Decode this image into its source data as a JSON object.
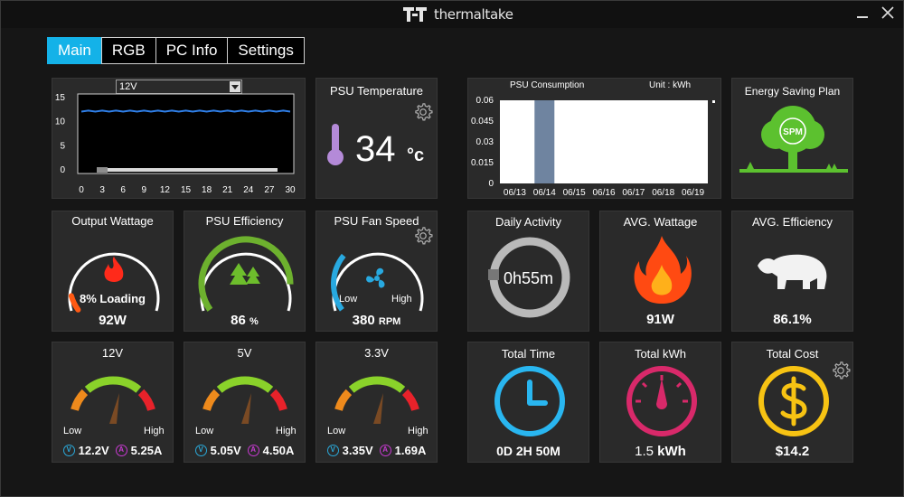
{
  "app": {
    "brand": "thermaltake"
  },
  "tabs": [
    "Main",
    "RGB",
    "PC Info",
    "Settings"
  ],
  "rail_chart": {
    "selected": "12V",
    "chart_data": {
      "type": "line",
      "series": [
        {
          "name": "12V",
          "values": [
            12.2,
            12.2,
            12.2,
            12.2,
            12.2,
            12.2,
            12.2,
            12.2,
            12.2,
            12.2,
            12.2,
            12.2,
            12.2,
            12.2,
            12.2,
            12.2,
            12.2,
            12.2,
            12.2,
            12.2,
            12.2,
            12.2,
            12.2,
            12.2,
            12.2,
            12.2,
            12.2,
            12.2,
            12.2,
            12.2,
            12.2
          ]
        }
      ],
      "x_ticks": [
        "0",
        "3",
        "6",
        "9",
        "12",
        "15",
        "18",
        "21",
        "24",
        "27",
        "30"
      ],
      "y_ticks": [
        "0",
        "5",
        "10",
        "15"
      ],
      "xlim": [
        0,
        30
      ],
      "ylim": [
        0,
        15
      ],
      "color": "#2f7fe8"
    }
  },
  "psu_temp": {
    "title": "PSU Temperature",
    "value": "34",
    "unit": "°c"
  },
  "consumption": {
    "title": "PSU Consumption",
    "unit_label": "Unit : kWh",
    "chart_data": {
      "type": "bar",
      "categories": [
        "06/13",
        "06/14",
        "06/15",
        "06/16",
        "06/17",
        "06/18",
        "06/19"
      ],
      "values": [
        0,
        0.06,
        0,
        0,
        0,
        0,
        0
      ],
      "y_ticks": [
        "0",
        "0.015",
        "0.03",
        "0.045",
        "0.06"
      ],
      "ylim": [
        0,
        0.06
      ],
      "color": "#6f84a0"
    }
  },
  "energy_plan": {
    "title": "Energy Saving Plan",
    "logo_text": "SPM"
  },
  "output_wattage": {
    "title": "Output Wattage",
    "loading": "8% Loading",
    "value": "92W",
    "percent": 8
  },
  "efficiency": {
    "title": "PSU Efficiency",
    "value": "86",
    "unit": "%",
    "percent": 86
  },
  "fan": {
    "title": "PSU Fan Speed",
    "low": "Low",
    "high": "High",
    "value": "380",
    "unit": "RPM",
    "percent": 30
  },
  "daily_activity": {
    "title": "Daily Activity",
    "value": "0h55m"
  },
  "avg_wattage": {
    "title": "AVG. Wattage",
    "value": "91W"
  },
  "avg_efficiency": {
    "title": "AVG. Efficiency",
    "value": "86.1%"
  },
  "rails": [
    {
      "title": "12V",
      "low": "Low",
      "high": "High",
      "voltage": "12.2V",
      "current": "5.25A",
      "v_badge": "V",
      "a_badge": "A"
    },
    {
      "title": "5V",
      "low": "Low",
      "high": "High",
      "voltage": "5.05V",
      "current": "4.50A",
      "v_badge": "V",
      "a_badge": "A"
    },
    {
      "title": "3.3V",
      "low": "Low",
      "high": "High",
      "voltage": "3.35V",
      "current": "1.69A",
      "v_badge": "V",
      "a_badge": "A"
    }
  ],
  "total_time": {
    "title": "Total Time",
    "value": "0D 2H 50M"
  },
  "total_kwh": {
    "title": "Total kWh",
    "value_num": "1.5",
    "value_unit": "kWh"
  },
  "total_cost": {
    "title": "Total Cost",
    "value": "$14.2"
  }
}
